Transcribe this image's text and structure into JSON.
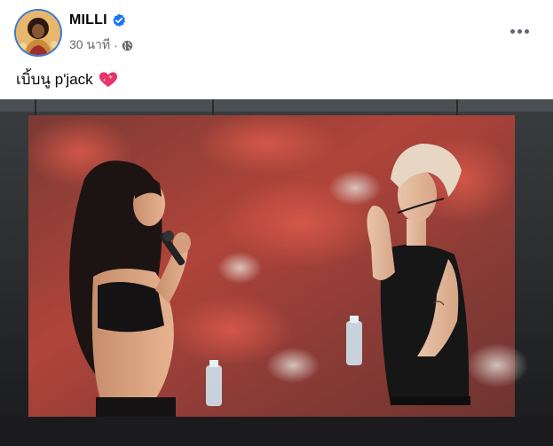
{
  "post": {
    "author": {
      "name": "MILLI",
      "verified": true,
      "avatar_icon": "profile-avatar"
    },
    "timestamp": "30 นาที",
    "privacy_icon": "globe-icon",
    "more_icon": "more-options-icon",
    "caption": "เบิ้บนู p'jack",
    "caption_emoji": "sparkling-heart-icon"
  },
  "colors": {
    "verified_blue": "#1877f2",
    "meta_gray": "#65676b",
    "text": "#050505",
    "heart_pink": "#e8336b"
  }
}
